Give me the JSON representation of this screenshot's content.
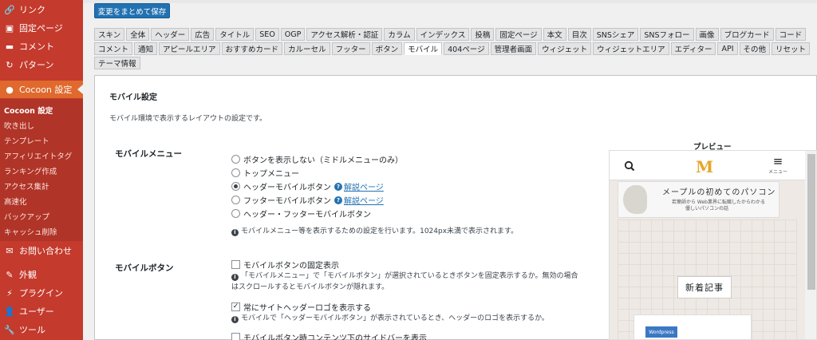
{
  "sidebar": {
    "top_items": [
      {
        "icon": "link-icon",
        "glyph": "🔗",
        "label": "リンク"
      },
      {
        "icon": "page-icon",
        "glyph": "▣",
        "label": "固定ページ"
      },
      {
        "icon": "comment-icon",
        "glyph": "▬",
        "label": "コメント"
      },
      {
        "icon": "pattern-icon",
        "glyph": "↻",
        "label": "パターン"
      }
    ],
    "active": {
      "icon": "cocoon-icon",
      "glyph": "●",
      "label": "Cocoon 設定"
    },
    "submenu": [
      "Cocoon 設定",
      "吹き出し",
      "テンプレート",
      "アフィリエイトタグ",
      "ランキング作成",
      "アクセス集計",
      "高速化",
      "バックアップ",
      "キャッシュ削除"
    ],
    "bottom_items": [
      {
        "icon": "mail-icon",
        "glyph": "✉",
        "label": "お問い合わせ"
      },
      {
        "icon": "appearance-icon",
        "glyph": "✎",
        "label": "外観"
      },
      {
        "icon": "plugin-icon",
        "glyph": "⚡",
        "label": "プラグイン"
      },
      {
        "icon": "user-icon",
        "glyph": "👤",
        "label": "ユーザー"
      },
      {
        "icon": "tools-icon",
        "glyph": "🔧",
        "label": "ツール"
      }
    ]
  },
  "toolbar": {
    "save_label": "変更をまとめて保存"
  },
  "tabs": {
    "row1": [
      "スキン",
      "全体",
      "ヘッダー",
      "広告",
      "タイトル",
      "SEO",
      "OGP",
      "アクセス解析・認証",
      "カラム",
      "インデックス",
      "投稿",
      "固定ページ",
      "本文",
      "目次",
      "SNSシェア",
      "SNSフォロー",
      "画像",
      "ブログカード",
      "コード"
    ],
    "row2": [
      "コメント",
      "通知",
      "アピールエリア",
      "おすすめカード",
      "カルーセル",
      "フッター",
      "ボタン",
      "モバイル",
      "404ページ",
      "管理者画面",
      "ウィジェット",
      "ウィジェットエリア",
      "エディター",
      "API",
      "その他",
      "リセット"
    ],
    "row3": [
      "テーマ情報"
    ],
    "active": "モバイル"
  },
  "panel": {
    "title": "モバイル設定",
    "description": "モバイル環境で表示するレイアウトの設定です。",
    "mobile_menu": {
      "label": "モバイルメニュー",
      "options": [
        {
          "label": "ボタンを表示しない（ミドルメニューのみ）",
          "checked": false,
          "help": ""
        },
        {
          "label": "トップメニュー",
          "checked": false,
          "help": ""
        },
        {
          "label": "ヘッダーモバイルボタン",
          "checked": true,
          "help": "解説ページ"
        },
        {
          "label": "フッターモバイルボタン",
          "checked": false,
          "help": "解説ページ"
        },
        {
          "label": "ヘッダー・フッターモバイルボタン",
          "checked": false,
          "help": ""
        }
      ],
      "info": "モバイルメニュー等を表示するための設定を行います。1024px未満で表示されます。"
    },
    "mobile_button": {
      "label": "モバイルボタン",
      "fixed_label": "モバイルボタンの固定表示",
      "fixed_checked": false,
      "fixed_info_line1": "「モバイルメニュー」で「モバイルボタン」が選択されているときボタンを固定表示するか。無効の場合",
      "fixed_info_line2": "はスクロールするとモバイルボタンが隠れます。",
      "logo_label": "常にサイトヘッダーロゴを表示する",
      "logo_checked": true,
      "logo_info": "モバイルで「ヘッダーモバイルボタン」が表示されているとき、ヘッダーのロゴを表示するか。",
      "sidebar_label": "モバイルボタン時コンテンツ下のサイドバーを表示",
      "sidebar_checked": false
    }
  },
  "preview": {
    "label": "プレビュー",
    "logo_letter": "M",
    "menu_label": "メニュー",
    "banner_title": "メープルの初めてのパソコン",
    "banner_sub1": "若葉師から Web業界に転職したからわかる",
    "banner_sub2": "優しいパソコンの話",
    "new_posts": "新着記事",
    "card_badge": "Wordpress"
  },
  "colors": {
    "sidebar": "#c43a2c",
    "active": "#e0692e",
    "primary": "#2271b1"
  }
}
